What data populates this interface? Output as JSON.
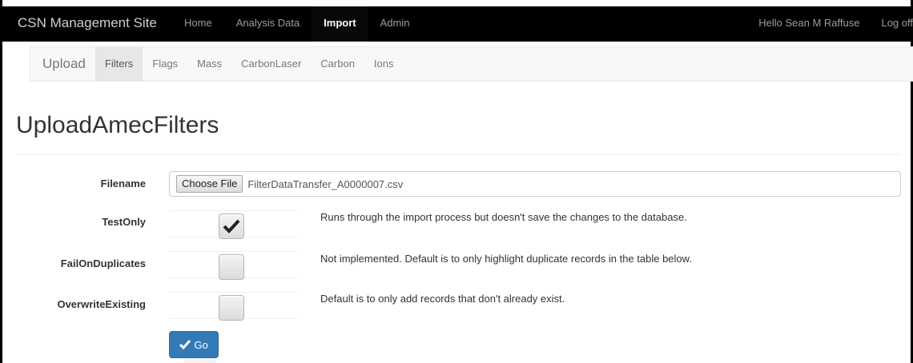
{
  "nav": {
    "brand": "CSN Management Site",
    "links": [
      {
        "label": "Home",
        "active": false
      },
      {
        "label": "Analysis Data",
        "active": false
      },
      {
        "label": "Import",
        "active": true
      },
      {
        "label": "Admin",
        "active": false
      }
    ],
    "greeting": "Hello Sean M Raffuse",
    "logoff": "Log off"
  },
  "subnav": {
    "brand": "Upload",
    "links": [
      {
        "label": "Filters",
        "active": true
      },
      {
        "label": "Flags",
        "active": false
      },
      {
        "label": "Mass",
        "active": false
      },
      {
        "label": "CarbonLaser",
        "active": false
      },
      {
        "label": "Carbon",
        "active": false
      },
      {
        "label": "Ions",
        "active": false
      }
    ]
  },
  "page": {
    "title": "UploadAmecFilters"
  },
  "form": {
    "filename": {
      "label": "Filename",
      "button_label": "Choose File",
      "value": "FilterDataTransfer_A0000007.csv"
    },
    "test_only": {
      "label": "TestOnly",
      "checked": true,
      "help": "Runs through the import process but doesn't save the changes to the database."
    },
    "fail_on_duplicates": {
      "label": "FailOnDuplicates",
      "checked": false,
      "help": "Not implemented. Default is to only highlight duplicate records in the table below."
    },
    "overwrite_existing": {
      "label": "OverwriteExisting",
      "checked": false,
      "help": "Default is to only add records that don't already exist."
    },
    "submit": {
      "label": "Go",
      "icon": "checkmark-icon"
    }
  },
  "colors": {
    "navbar_bg": "#000000",
    "primary": "#337ab7",
    "subnav_bg": "#f8f8f8"
  }
}
